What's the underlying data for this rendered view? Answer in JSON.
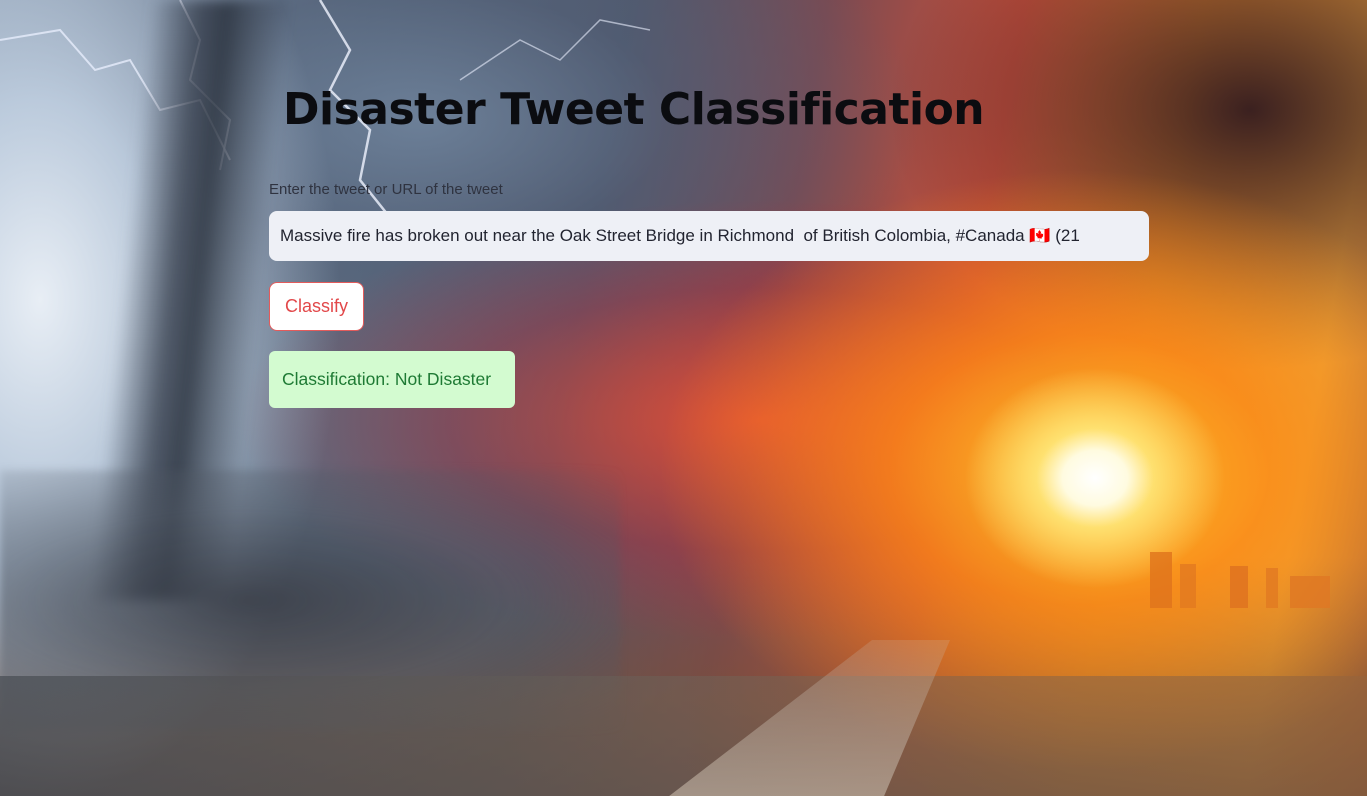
{
  "page": {
    "title": "Disaster Tweet Classification"
  },
  "form": {
    "input_label": "Enter the tweet or URL of the tweet",
    "input_value": "Massive fire has broken out near the Oak Street Bridge in Richmond  of British Colombia, #Canada 🇨🇦 (21",
    "classify_label": "Classify"
  },
  "result": {
    "text": "Classification: Not Disaster"
  },
  "colors": {
    "button_accent": "#e2484a",
    "success_bg": "#d3fbd0",
    "success_text": "#1e7a34"
  }
}
